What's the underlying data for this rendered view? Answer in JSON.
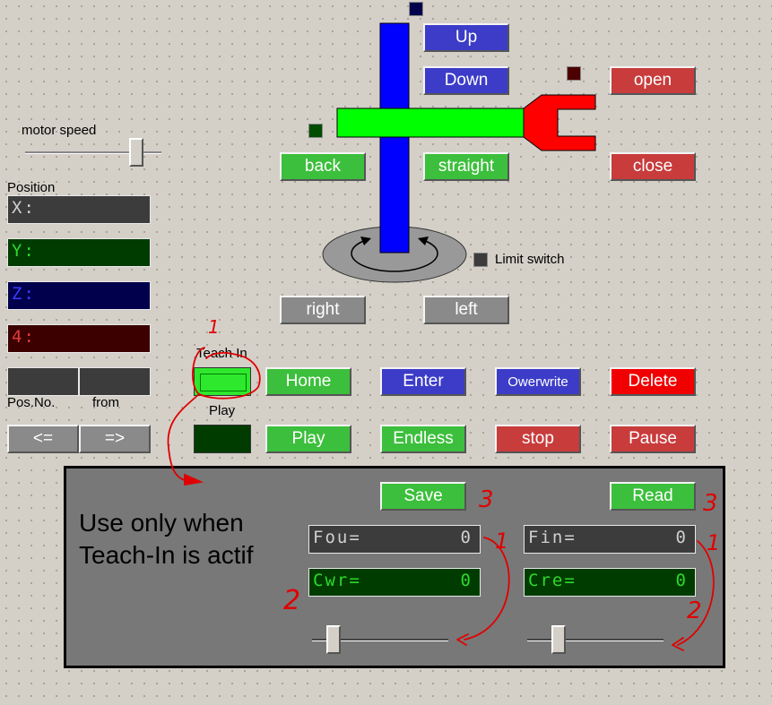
{
  "motor": {
    "speed_label": "motor speed",
    "speed_value": 0.85
  },
  "position": {
    "title": "Position",
    "x": "X:",
    "y": "Y:",
    "z": "Z:",
    "four": "4:",
    "pos_no_label": "Pos.No.",
    "from_label": "from",
    "prev_label": "<=",
    "next_label": "=>"
  },
  "controls": {
    "up": "Up",
    "down": "Down",
    "open": "open",
    "back": "back",
    "straight": "straight",
    "close": "close",
    "right": "right",
    "left": "left",
    "limit_switch": "Limit switch"
  },
  "teach": {
    "teach_in_label": "Teach In",
    "play_label": "Play",
    "home": "Home",
    "enter": "Enter",
    "overwrite": "Owerwrite",
    "delete": "Delete",
    "play": "Play",
    "endless": "Endless",
    "stop": "stop",
    "pause": "Pause"
  },
  "panel": {
    "note_line1": "Use only when",
    "note_line2": "Teach-In is actif",
    "save": "Save",
    "read": "Read",
    "fou_label": "Fou=",
    "fou_value": "0",
    "cwr_label": "Cwr=",
    "cwr_value": "0",
    "fin_label": "Fin=",
    "fin_value": "0",
    "cre_label": "Cre=",
    "cre_value": "0",
    "slider_left_value": 0.12,
    "slider_right_value": 0.2
  },
  "annotations": {
    "num1a": "1",
    "num1b": "1",
    "num1c": "1",
    "num2a": "2",
    "num2b": "2",
    "num3a": "3",
    "num3b": "3"
  },
  "colors": {
    "green": "#3cbf3c",
    "blue": "#3c3cc8",
    "red": "#c83c3c",
    "bright_red": "#f00000",
    "arm_blue": "#0000ff",
    "gripper_arm": "#00ff00",
    "gripper_jaw": "#ff0000",
    "annotation": "#e00000"
  }
}
